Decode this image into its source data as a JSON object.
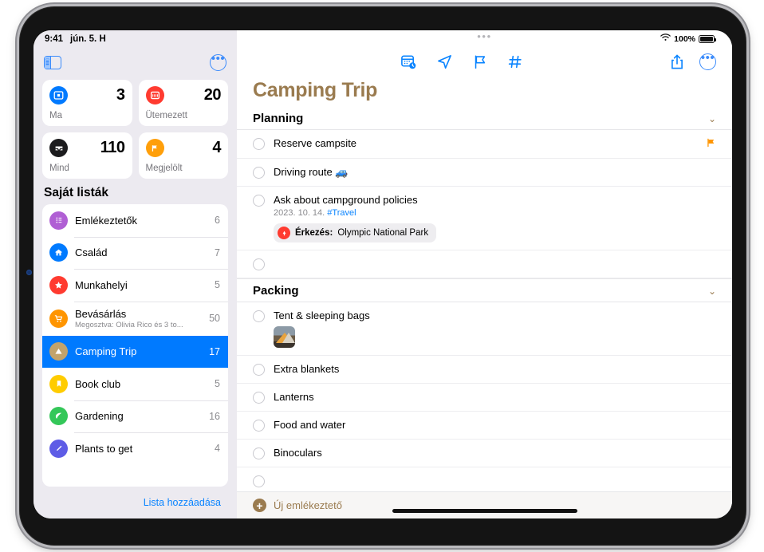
{
  "status_bar": {
    "time": "9:41",
    "date": "jún. 5. H",
    "wifi_icon": "wifi-icon",
    "battery_percent": "100%"
  },
  "sidebar": {
    "toggle_icon": "sidebar-toggle-icon",
    "more_icon": "more-circle-icon",
    "smart_lists": [
      {
        "label": "Ma",
        "count": "3",
        "icon": "today-calendar-icon",
        "color": "#007aff"
      },
      {
        "label": "Ütemezett",
        "count": "20",
        "icon": "scheduled-calendar-icon",
        "color": "#ff3b30"
      },
      {
        "label": "Mind",
        "count": "110",
        "icon": "all-inbox-icon",
        "color": "#1c1c1e"
      },
      {
        "label": "Megjelölt",
        "count": "4",
        "icon": "flagged-flag-icon",
        "color": "#ff9f0a"
      }
    ],
    "section_title": "Saját listák",
    "lists": [
      {
        "name": "Emlékeztetők",
        "count": "6",
        "icon": "bullet-list-icon",
        "color": "#b05fd4",
        "subtitle": "",
        "selected": false
      },
      {
        "name": "Család",
        "count": "7",
        "icon": "home-icon",
        "color": "#007aff",
        "subtitle": "",
        "selected": false
      },
      {
        "name": "Munkahelyi",
        "count": "5",
        "icon": "star-icon",
        "color": "#ff3b30",
        "subtitle": "",
        "selected": false
      },
      {
        "name": "Bevásárlás",
        "count": "50",
        "icon": "shopping-cart-icon",
        "color": "#ff9500",
        "subtitle": "Megosztva: Olivia Rico és 3 to...",
        "selected": false
      },
      {
        "name": "Camping Trip",
        "count": "17",
        "icon": "tent-triangle-icon",
        "color": "#c2a36b",
        "subtitle": "",
        "selected": true
      },
      {
        "name": "Book club",
        "count": "5",
        "icon": "bookmark-icon",
        "color": "#ffcc00",
        "subtitle": "",
        "selected": false
      },
      {
        "name": "Gardening",
        "count": "16",
        "icon": "leaf-icon",
        "color": "#34c759",
        "subtitle": "",
        "selected": false
      },
      {
        "name": "Plants to get",
        "count": "4",
        "icon": "paintbrush-icon",
        "color": "#5e5ce6",
        "subtitle": "",
        "selected": false
      }
    ],
    "add_list_label": "Lista hozzáadása"
  },
  "detail": {
    "grabber": "•••",
    "title": "Camping Trip",
    "title_color": "#9a7b4f",
    "toolbar": {
      "center_buttons": [
        {
          "icon": "calendar-clock-icon",
          "name": "show-dates-button"
        },
        {
          "icon": "location-arrow-icon",
          "name": "show-location-button"
        },
        {
          "icon": "flag-icon",
          "name": "show-flag-button"
        },
        {
          "icon": "hashtag-icon",
          "name": "show-tags-button"
        }
      ],
      "right_buttons": [
        {
          "icon": "share-icon",
          "name": "share-button"
        },
        {
          "icon": "more-circle-icon",
          "name": "more-options-button"
        }
      ]
    },
    "groups": [
      {
        "title": "Planning",
        "chevron": "⌄",
        "tasks": [
          {
            "title": "Reserve campsite",
            "meta": "",
            "tag": "",
            "flagged": true,
            "chip": null,
            "thumb": false,
            "empty": false
          },
          {
            "title": "Driving route 🚙",
            "meta": "",
            "tag": "",
            "flagged": false,
            "chip": null,
            "thumb": false,
            "empty": false
          },
          {
            "title": "Ask about campground policies",
            "meta": "2023. 10. 14.",
            "tag": "#Travel",
            "flagged": false,
            "chip": {
              "label": "Érkezés:",
              "value": "Olympic National Park",
              "icon": "location-pin-icon"
            },
            "thumb": false,
            "empty": false
          },
          {
            "title": "",
            "meta": "",
            "tag": "",
            "flagged": false,
            "chip": null,
            "thumb": false,
            "empty": true
          }
        ]
      },
      {
        "title": "Packing",
        "chevron": "⌄",
        "tasks": [
          {
            "title": "Tent & sleeping bags",
            "meta": "",
            "tag": "",
            "flagged": false,
            "chip": null,
            "thumb": true,
            "empty": false
          },
          {
            "title": "Extra blankets",
            "meta": "",
            "tag": "",
            "flagged": false,
            "chip": null,
            "thumb": false,
            "empty": false
          },
          {
            "title": "Lanterns",
            "meta": "",
            "tag": "",
            "flagged": false,
            "chip": null,
            "thumb": false,
            "empty": false
          },
          {
            "title": "Food and water",
            "meta": "",
            "tag": "",
            "flagged": false,
            "chip": null,
            "thumb": false,
            "empty": false
          },
          {
            "title": "Binoculars",
            "meta": "",
            "tag": "",
            "flagged": false,
            "chip": null,
            "thumb": false,
            "empty": false
          },
          {
            "title": "",
            "meta": "",
            "tag": "",
            "flagged": false,
            "chip": null,
            "thumb": false,
            "empty": true
          }
        ]
      }
    ],
    "new_reminder_label": "Új emlékeztető",
    "new_reminder_icon": "plus-circle-icon"
  }
}
